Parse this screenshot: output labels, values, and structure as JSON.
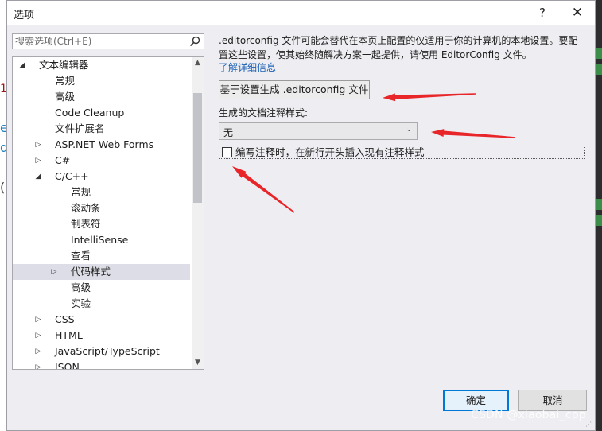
{
  "dialog": {
    "title": "选项",
    "help_glyph": "?",
    "close_glyph": "✕"
  },
  "search": {
    "placeholder": "搜索选项(Ctrl+E)"
  },
  "tree": {
    "items": [
      {
        "label": "文本编辑器",
        "level": 0,
        "expander": "expanded"
      },
      {
        "label": "常规",
        "level": 1,
        "expander": "none"
      },
      {
        "label": "高级",
        "level": 1,
        "expander": "none"
      },
      {
        "label": "Code Cleanup",
        "level": 1,
        "expander": "none"
      },
      {
        "label": "文件扩展名",
        "level": 1,
        "expander": "none"
      },
      {
        "label": "ASP.NET Web Forms",
        "level": 1,
        "expander": "collapsed"
      },
      {
        "label": "C#",
        "level": 1,
        "expander": "collapsed"
      },
      {
        "label": "C/C++",
        "level": 1,
        "expander": "expanded"
      },
      {
        "label": "常规",
        "level": 2,
        "expander": "none"
      },
      {
        "label": "滚动条",
        "level": 2,
        "expander": "none"
      },
      {
        "label": "制表符",
        "level": 2,
        "expander": "none"
      },
      {
        "label": "IntelliSense",
        "level": 2,
        "expander": "none"
      },
      {
        "label": "查看",
        "level": 2,
        "expander": "none"
      },
      {
        "label": "代码样式",
        "level": 2,
        "expander": "collapsed",
        "selected": true
      },
      {
        "label": "高级",
        "level": 2,
        "expander": "none"
      },
      {
        "label": "实验",
        "level": 2,
        "expander": "none"
      },
      {
        "label": "CSS",
        "level": 1,
        "expander": "collapsed"
      },
      {
        "label": "HTML",
        "level": 1,
        "expander": "collapsed"
      },
      {
        "label": "JavaScript/TypeScript",
        "level": 1,
        "expander": "collapsed"
      },
      {
        "label": "JSON",
        "level": 1,
        "expander": "collapsed"
      }
    ]
  },
  "content": {
    "description_line1": ".editorconfig 文件可能会替代在本页上配置的仅适用于你的计算机的本地设置。要配",
    "description_line2": "置这些设置，使其始终随解决方案一起提供，请使用 EditorConfig 文件。",
    "learn_more_link": "了解详细信息",
    "generate_button": "基于设置生成 .editorconfig 文件",
    "comment_style_label": "生成的文档注释样式:",
    "comment_style_value": "无",
    "insert_comment_checkbox_label": "编写注释时，在新行开头插入现有注释样式",
    "insert_comment_checked": false
  },
  "footer": {
    "ok_label": "确定",
    "cancel_label": "取消"
  },
  "watermark": "CSDN @xiaobai_cpp",
  "colors": {
    "annotation_arrow": "#e8262a",
    "selection": "#dcdde6",
    "ok_border": "#0078d7",
    "link": "#1a5fb4"
  }
}
